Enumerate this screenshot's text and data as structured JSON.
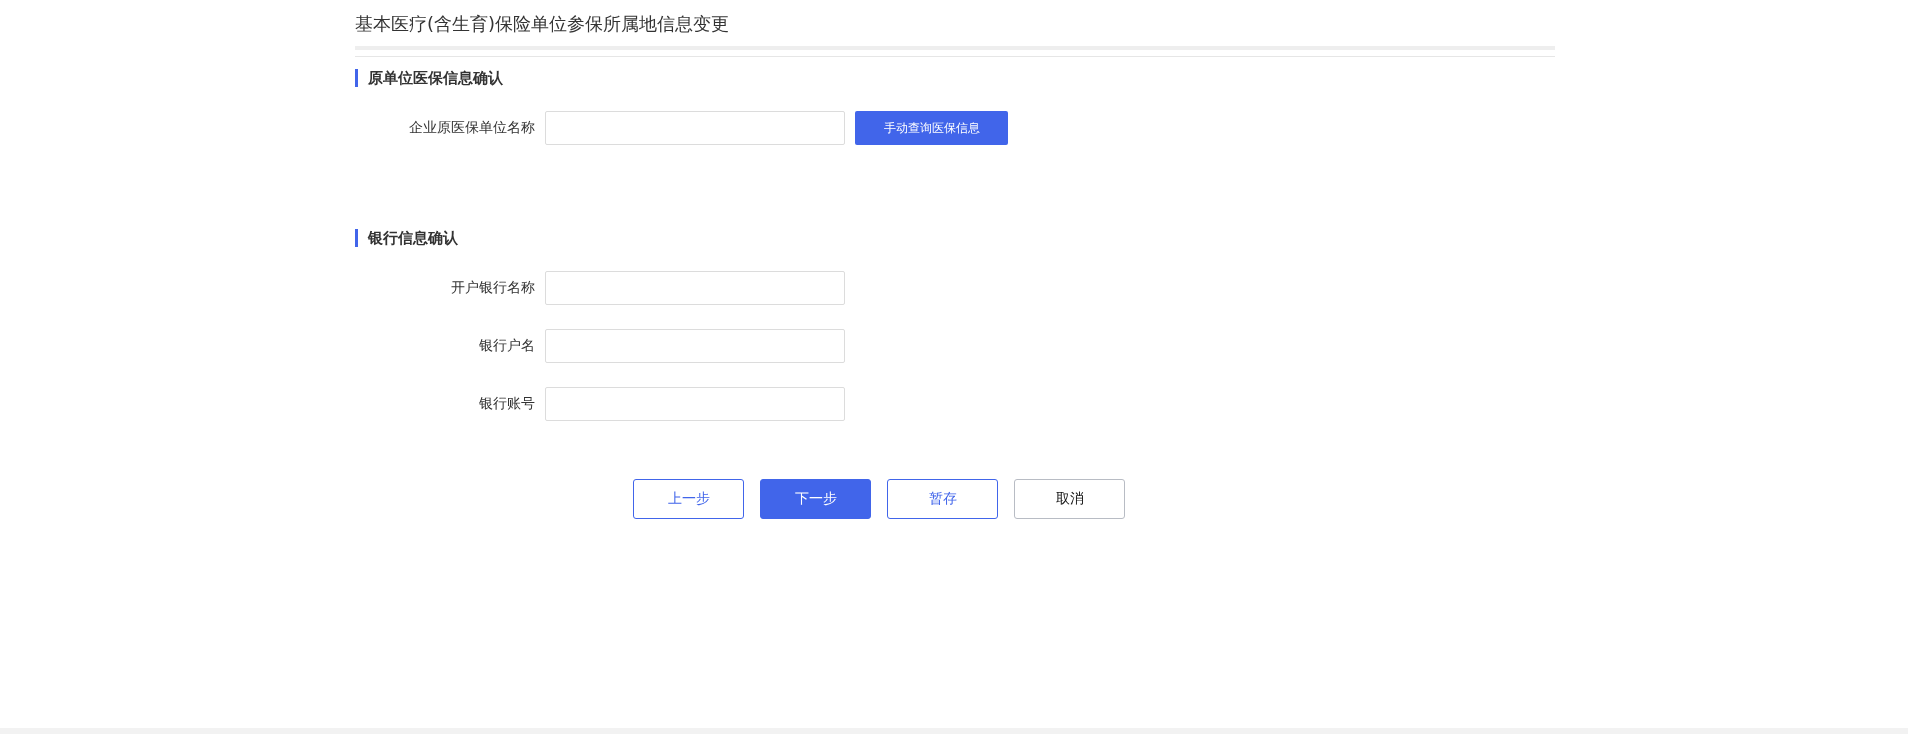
{
  "page_title": "基本医疗(含生育)保险单位参保所属地信息变更",
  "sections": [
    {
      "heading": "原单位医保信息确认",
      "fields": [
        {
          "label": "企业原医保单位名称",
          "action": "手动查询医保信息"
        }
      ]
    },
    {
      "heading": "银行信息确认",
      "fields": [
        {
          "label": "开户银行名称"
        },
        {
          "label": "银行户名"
        },
        {
          "label": "银行账号"
        }
      ]
    }
  ],
  "buttons": [
    {
      "label": "上一步",
      "kind": "outline"
    },
    {
      "label": "下一步",
      "kind": "primary"
    },
    {
      "label": "暂存",
      "kind": "outline"
    },
    {
      "label": "取消",
      "kind": "plain"
    }
  ]
}
